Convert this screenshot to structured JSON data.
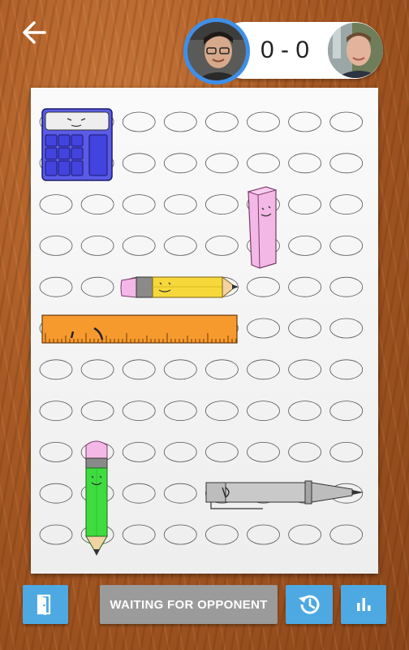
{
  "header": {
    "score": "0 - 0"
  },
  "status": {
    "label": "WAITING FOR OPPONENT"
  },
  "colors": {
    "accent": "#4ea9e2",
    "status_gray": "#9b9b9b",
    "ring_blue": "#3f8fe8"
  },
  "board": {
    "columns": 8,
    "rows": 11,
    "pieces": [
      {
        "name": "calculator",
        "color": "#5b5be8"
      },
      {
        "name": "eraser",
        "color": "#f4b8e6"
      },
      {
        "name": "yellow-pencil",
        "color": "#f6d83b"
      },
      {
        "name": "ruler",
        "color": "#f79a2e"
      },
      {
        "name": "green-pencil",
        "color": "#3fdc3f"
      },
      {
        "name": "pen",
        "color": "#bdbdbd"
      }
    ]
  },
  "icons": {
    "back": "arrow-left-icon",
    "leave": "door-exit-icon",
    "history": "history-icon",
    "stats": "bar-chart-icon"
  }
}
